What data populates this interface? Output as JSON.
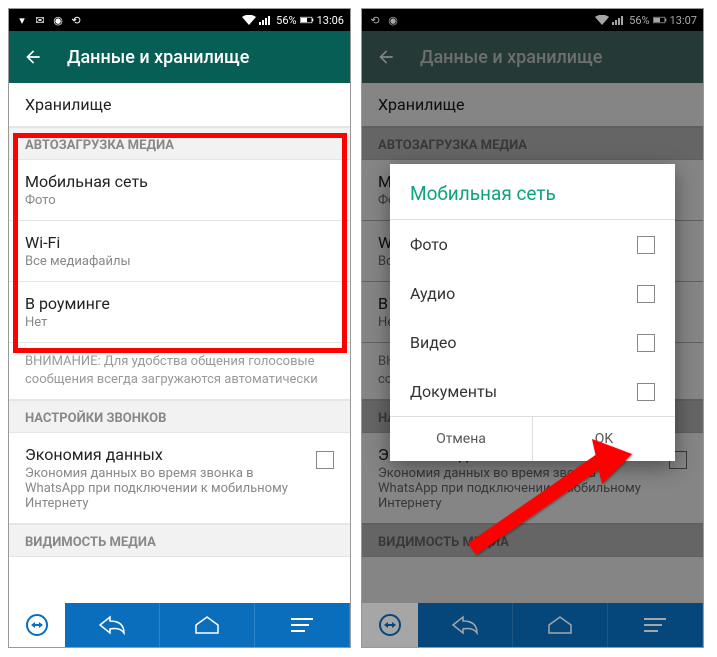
{
  "left": {
    "statusbar": {
      "battery": "56%",
      "time": "13:06"
    },
    "appbar": {
      "title": "Данные и хранилище"
    },
    "storage_item": "Хранилище",
    "section_autoload": "АВТОЗАГРУЗКА МЕДИА",
    "mobile": {
      "title": "Мобильная сеть",
      "sub": "Фото"
    },
    "wifi": {
      "title": "Wi-Fi",
      "sub": "Все медиафайлы"
    },
    "roaming": {
      "title": "В роуминге",
      "sub": "Нет"
    },
    "note": "ВНИМАНИЕ: Для удобства общения голосовые сообщения всегда загружаются автоматически",
    "section_calls": "НАСТРОЙКИ ЗВОНКОВ",
    "low_data": {
      "title": "Экономия данных",
      "sub": "Экономия данных во время звонка в WhatsApp при подключении к мобильному Интернету"
    },
    "section_media_vis": "ВИДИМОСТЬ МЕДИА"
  },
  "right": {
    "statusbar": {
      "battery": "56%",
      "time": "13:07"
    },
    "appbar": {
      "title": "Данные и хранилище"
    },
    "dialog": {
      "title": "Мобильная сеть",
      "photo": "Фото",
      "audio": "Аудио",
      "video": "Видео",
      "docs": "Документы",
      "cancel": "Отмена",
      "ok": "OK"
    }
  }
}
